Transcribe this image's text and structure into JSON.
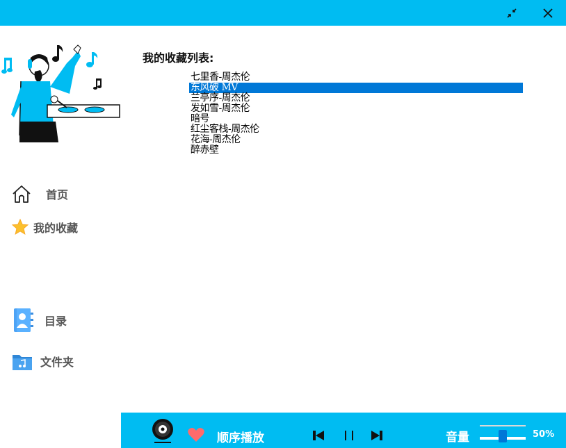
{
  "window": {
    "minimize_icon": "collapse-arrows-icon",
    "close_icon": "close-icon"
  },
  "sidebar": {
    "items": [
      {
        "label": "首页",
        "icon": "home-icon"
      },
      {
        "label": "我的收藏",
        "icon": "star-icon"
      },
      {
        "label": "目录",
        "icon": "contacts-book-icon"
      },
      {
        "label": "文件夹",
        "icon": "music-folder-icon"
      }
    ]
  },
  "main": {
    "title": "我的收藏列表:",
    "list": [
      "七里香-周杰伦",
      "东风破 MV",
      "兰亭序-周杰伦",
      "发如雪-周杰伦",
      "暗号",
      "红尘客栈-周杰伦",
      "花海-周杰伦",
      "醉赤壁"
    ],
    "selected_index": 1
  },
  "player": {
    "mode_label": "顺序播放",
    "volume_label": "音量",
    "volume_percent": "50%",
    "volume_value": 0.5,
    "colors": {
      "accent": "#00bcf2",
      "selection": "#0078d7",
      "heart": "#ff6b6b"
    }
  }
}
